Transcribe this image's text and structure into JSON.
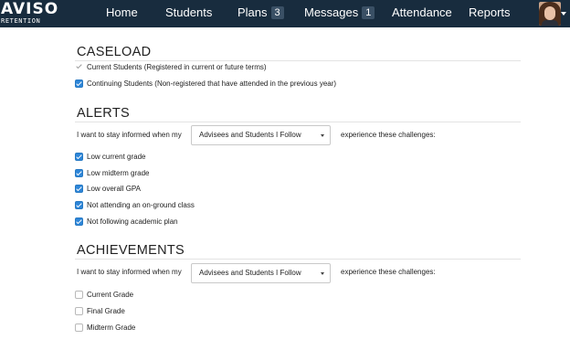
{
  "nav": {
    "logo_main": "AVISO",
    "logo_sub": "RETENTION",
    "items": [
      {
        "label": "Home"
      },
      {
        "label": "Students"
      },
      {
        "label": "Plans",
        "badge": "3"
      },
      {
        "label": "Messages",
        "badge": "1"
      },
      {
        "label": "Attendance"
      },
      {
        "label": "Reports"
      }
    ],
    "avatar_icon": "user-avatar",
    "caret_icon": "caret-down-icon"
  },
  "caseload": {
    "title": "CASELOAD",
    "options": [
      {
        "label": "Current Students (Registered in current or future terms)",
        "state": "disabled-checked"
      },
      {
        "label": "Continuing Students (Non-registered that have attended in the previous year)",
        "state": "checked"
      }
    ]
  },
  "alerts": {
    "title": "ALERTS",
    "inform_prefix": "I want to stay informed when my",
    "select_value": "Advisees and Students I Follow",
    "inform_suffix": "experience these challenges:",
    "options": [
      {
        "label": "Low current grade",
        "state": "checked"
      },
      {
        "label": "Low midterm grade",
        "state": "checked"
      },
      {
        "label": "Low overall GPA",
        "state": "checked"
      },
      {
        "label": "Not attending an on-ground class",
        "state": "checked"
      },
      {
        "label": "Not following academic plan",
        "state": "checked"
      }
    ]
  },
  "achievements": {
    "title": "ACHIEVEMENTS",
    "inform_prefix": "I want to stay informed when my",
    "select_value": "Advisees and Students I Follow",
    "inform_suffix": "experience these challenges:",
    "options": [
      {
        "label": "Current Grade",
        "state": "unchecked"
      },
      {
        "label": "Final Grade",
        "state": "unchecked"
      },
      {
        "label": "Midterm Grade",
        "state": "unchecked"
      }
    ]
  },
  "colors": {
    "navbar": "#182c3e",
    "checkbox_accent": "#2e86d8",
    "badge": "#3a5065"
  }
}
